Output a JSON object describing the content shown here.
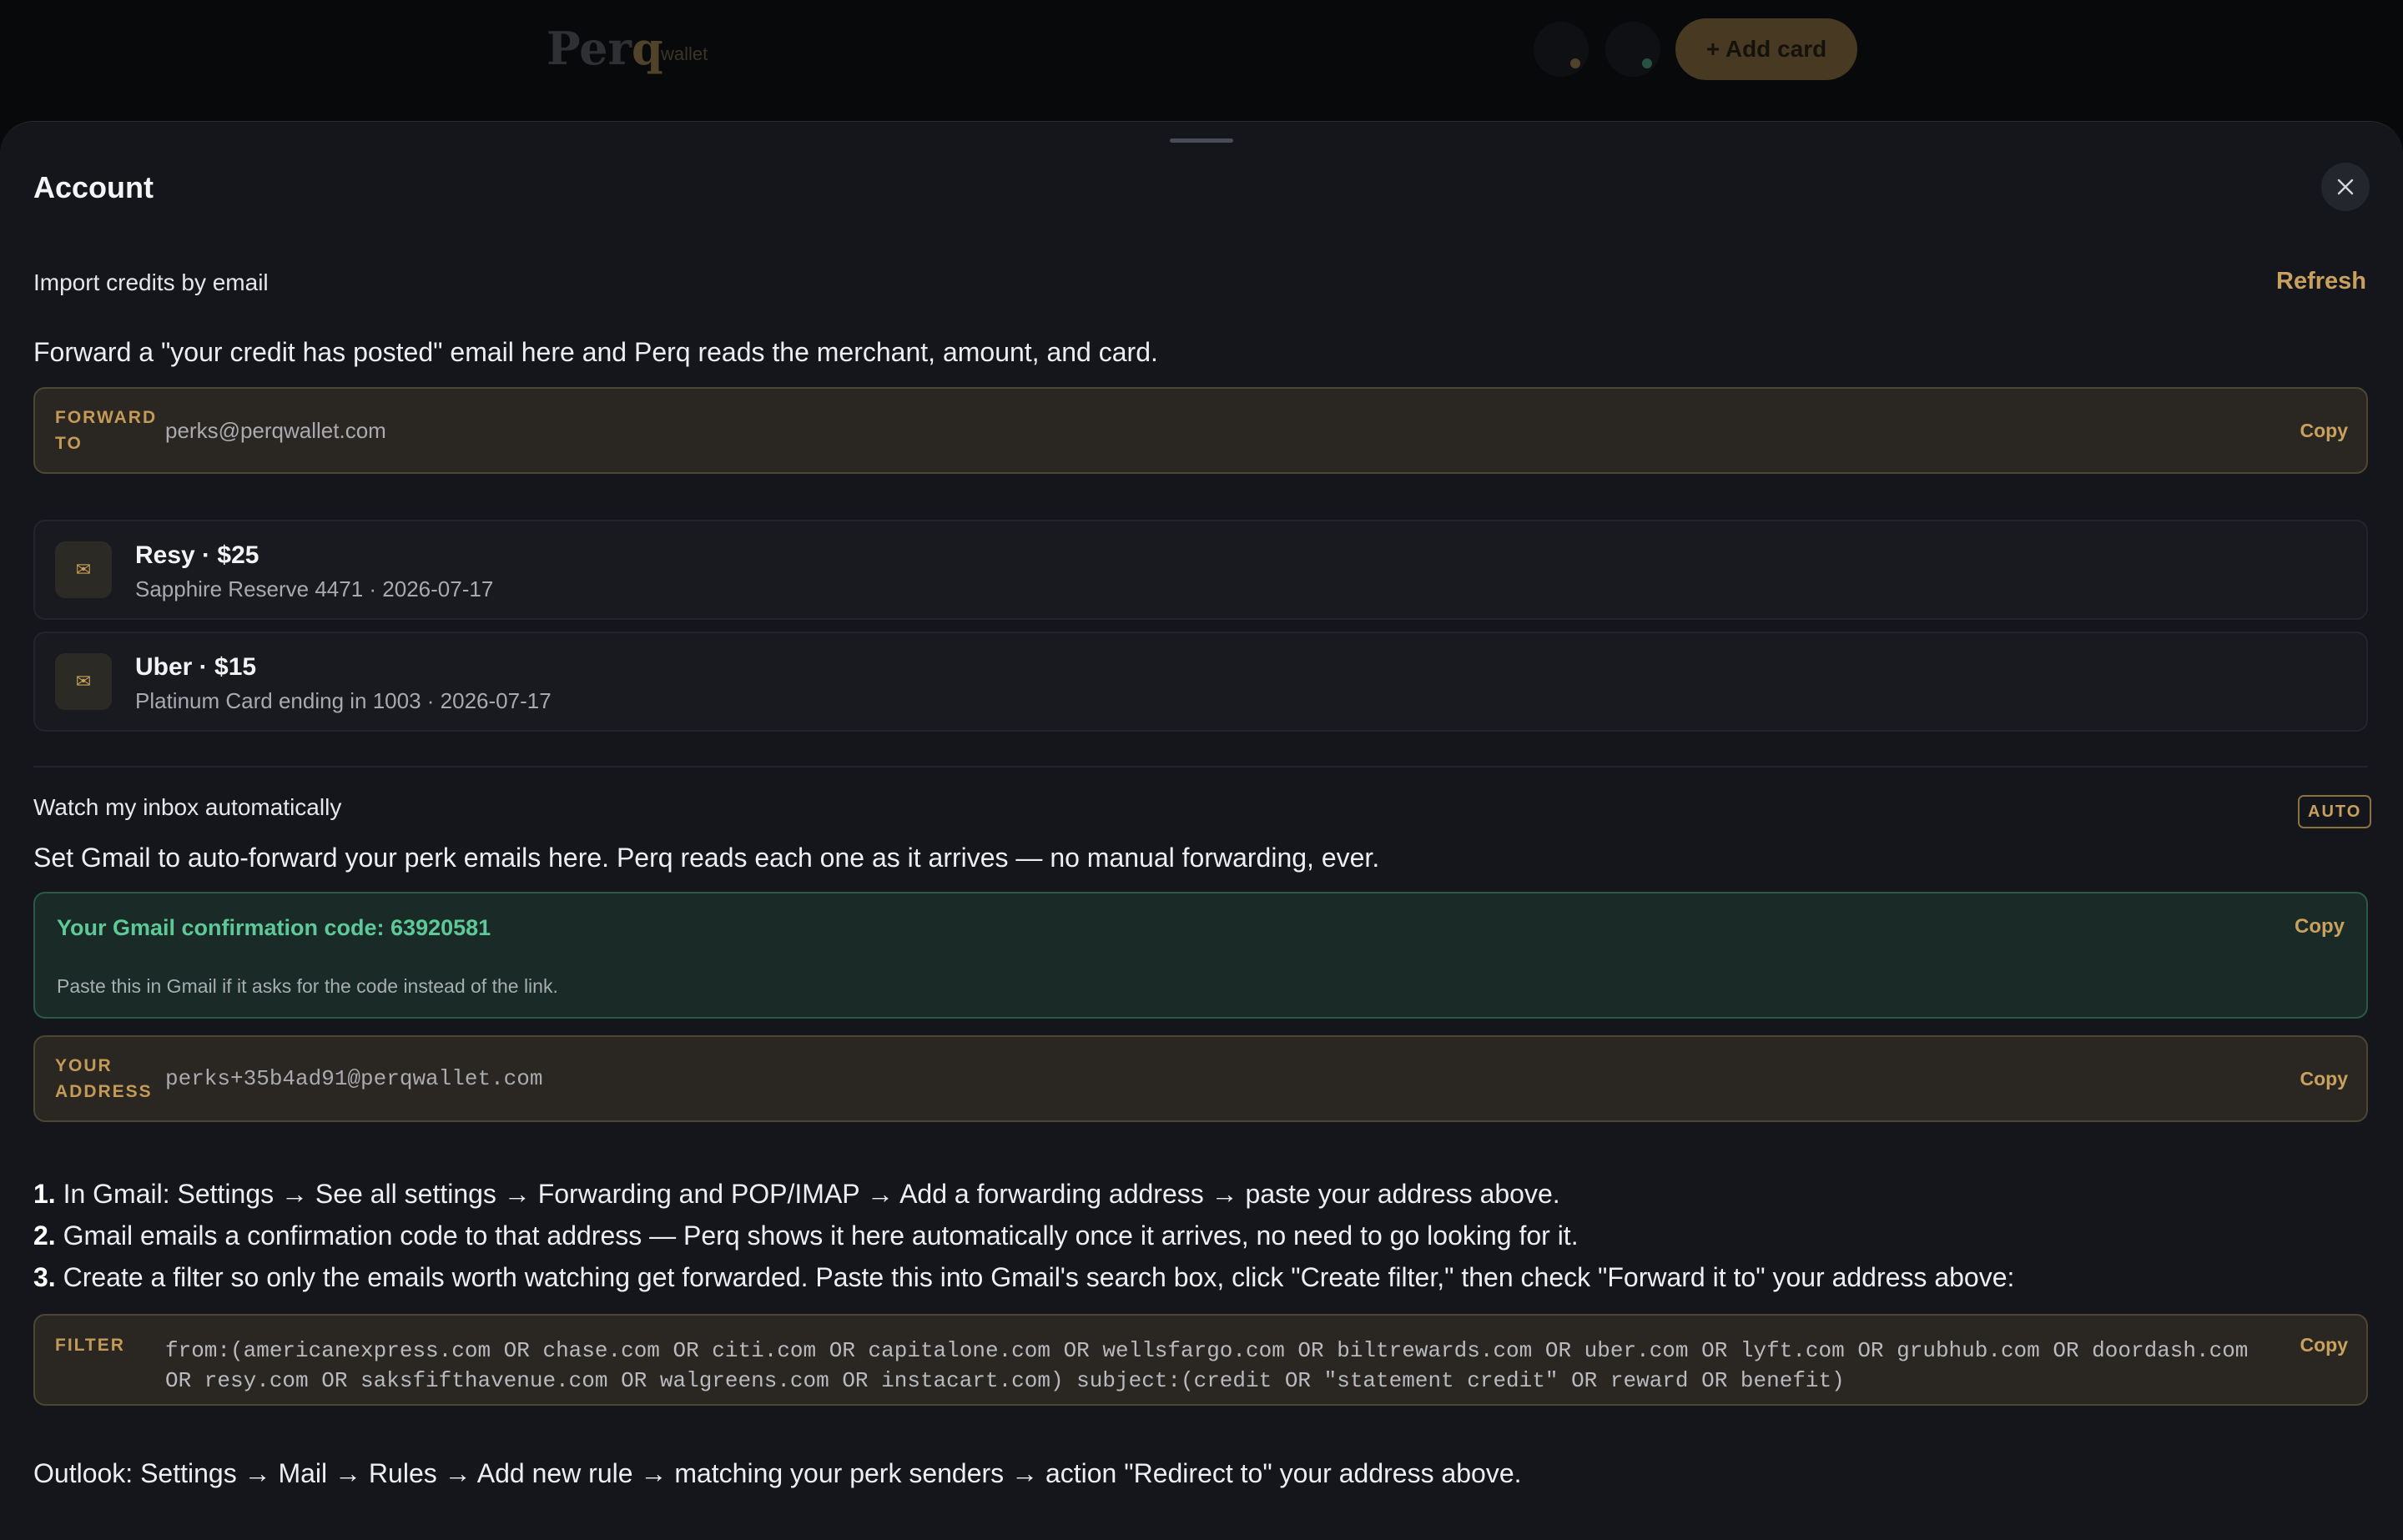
{
  "background": {
    "logo_main": "Per",
    "logo_accent": "q",
    "logo_sub": "wallet",
    "add_button": "+ Add card"
  },
  "sheet": {
    "title": "Account"
  },
  "import": {
    "label": "Import credits by email",
    "refresh": "Refresh",
    "description": "Forward a \"your credit has posted\" email here and Perq reads the merchant, amount, and card.",
    "forward_label_1": "FORWARD",
    "forward_label_2": "TO",
    "forward_address": "perks@perqwallet.com",
    "copy": "Copy"
  },
  "credits": [
    {
      "icon": "✉",
      "name": "Resy · $25",
      "meta": "Sapphire Reserve 4471 · 2026-07-17"
    },
    {
      "icon": "✉",
      "name": "Uber · $15",
      "meta": "Platinum Card ending in 1003 · 2026-07-17"
    }
  ],
  "watch": {
    "label": "Watch my inbox automatically",
    "badge": "AUTO",
    "description": "Set Gmail to auto-forward your perk emails here. Perq reads each one as it arrives — no manual forwarding, ever.",
    "code_title": "Your Gmail confirmation code: 63920581",
    "code_sub": "Paste this in Gmail if it asks for the code instead of the link.",
    "code_copy": "Copy",
    "address_label_1": "YOUR",
    "address_label_2": "ADDRESS",
    "address": "perks+35b4ad91@perqwallet.com",
    "address_copy": "Copy"
  },
  "steps": [
    {
      "num": "1.",
      "text": " In Gmail: Settings → See all settings → Forwarding and POP/IMAP → Add a forwarding address → paste your address above."
    },
    {
      "num": "2.",
      "text": " Gmail emails a confirmation code to that address — Perq shows it here automatically once it arrives, no need to go looking for it."
    },
    {
      "num": "3.",
      "text": " Create a filter so only the emails worth watching get forwarded. Paste this into Gmail's search box, click \"Create filter,\" then check \"Forward it to\" your address above:"
    }
  ],
  "filter": {
    "label": "FILTER",
    "text": "from:(americanexpress.com OR chase.com OR citi.com OR capitalone.com OR wellsfargo.com OR biltrewards.com OR uber.com OR lyft.com OR grubhub.com OR doordash.com OR resy.com OR saksfifthavenue.com OR walgreens.com OR instacart.com) subject:(credit OR \"statement credit\" OR reward OR benefit)",
    "copy": "Copy"
  },
  "outlook": {
    "text": "Outlook: Settings → Mail → Rules → Add new rule → matching your perk senders → action \"Redirect to\" your address above."
  },
  "colors": {
    "accent_gold": "#c9a15e",
    "success_green": "#5ec998",
    "sheet_bg": "#14161b"
  }
}
